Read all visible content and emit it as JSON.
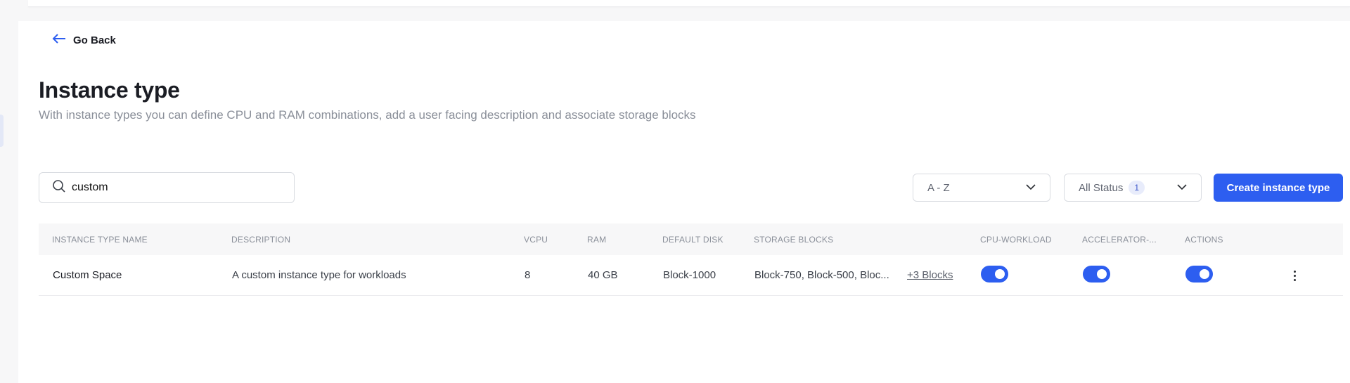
{
  "header": {
    "go_back_label": "Go Back",
    "title": "Instance type",
    "subtitle": "With instance types you can define CPU and RAM combinations, add a user facing description and associate storage blocks"
  },
  "filters": {
    "search_value": "custom",
    "sort_value": "A - Z",
    "status_value": "All Status",
    "status_count": "1",
    "create_label": "Create instance type"
  },
  "table": {
    "columns": [
      "INSTANCE TYPE NAME",
      "DESCRIPTION",
      "VCPU",
      "RAM",
      "DEFAULT DISK",
      "STORAGE BLOCKS",
      "CPU-WORKLOAD",
      "ACCELERATOR-...",
      "ACTIONS"
    ],
    "rows": [
      {
        "name": "Custom Space",
        "description": "A custom instance type for workloads",
        "vcpu": "8",
        "ram": "40 GB",
        "default_disk": "Block-1000",
        "storage_blocks": "Block-750, Block-500, Bloc...",
        "more_blocks": "+3 Blocks",
        "cpu_workload": true,
        "accelerator": true,
        "actions_toggle": true
      }
    ]
  },
  "colors": {
    "accent": "#2d5ef0",
    "muted_text": "#8a8f99"
  },
  "icons": {
    "back": "arrow-left-icon",
    "search": "search-icon",
    "sort": "chevron-down-icon",
    "sidebar": "expand-sidebar-icon",
    "kebab": "kebab-menu-icon"
  }
}
